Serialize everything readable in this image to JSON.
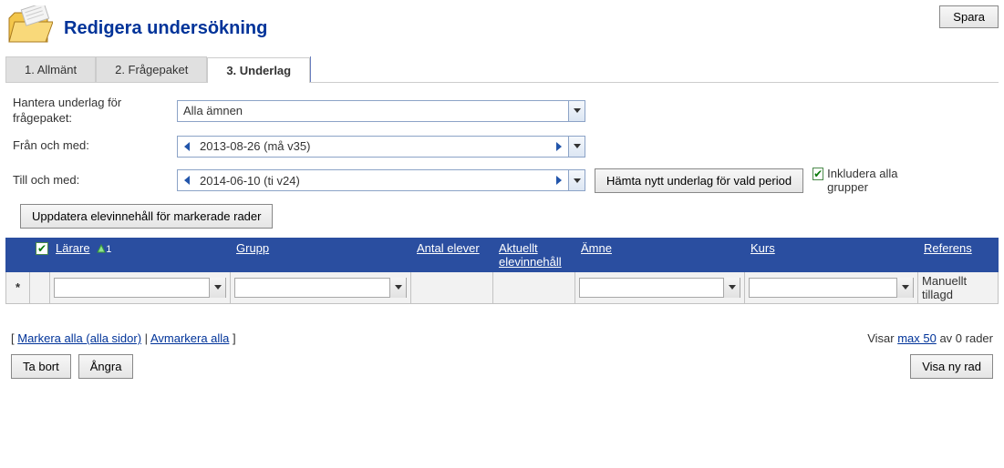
{
  "header": {
    "title": "Redigera undersökning",
    "save_label": "Spara"
  },
  "tabs": [
    {
      "label": "1. Allmänt",
      "active": false
    },
    {
      "label": "2. Frågepaket",
      "active": false
    },
    {
      "label": "3. Underlag",
      "active": true
    }
  ],
  "form": {
    "subject_filter_label": "Hantera underlag för frågepaket:",
    "subject_filter_value": "Alla ämnen",
    "from_label": "Från och med:",
    "from_value": "2013-08-26 (må v35)",
    "to_label": "Till och med:",
    "to_value": "2014-06-10 (ti v24)",
    "fetch_button": "Hämta nytt underlag för vald period",
    "include_all_label": "Inkludera alla grupper",
    "update_button": "Uppdatera elevinnehåll för markerade rader"
  },
  "grid": {
    "columns": {
      "larare": "Lärare",
      "grupp": "Grupp",
      "antal_elever": "Antal elever",
      "aktuellt": "Aktuellt elevinnehåll",
      "amne": "Ämne",
      "kurs": "Kurs",
      "referens": "Referens"
    },
    "sort_indicator": "1",
    "rows": [
      {
        "referens": "Manuellt tillagd"
      }
    ]
  },
  "footer": {
    "select_all": "Markera alla (alla sidor)",
    "deselect_all": "Avmarkera alla",
    "showing_prefix": "Visar ",
    "showing_max": "max 50",
    "showing_suffix": " av 0 rader",
    "delete_label": "Ta bort",
    "undo_label": "Ångra",
    "new_row_label": "Visa ny rad"
  }
}
